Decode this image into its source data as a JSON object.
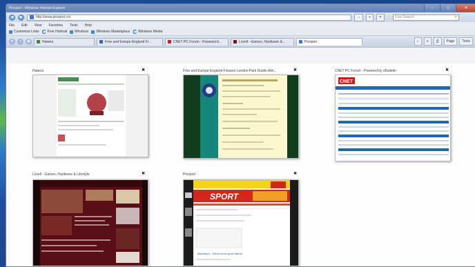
{
  "window": {
    "title": "Pinsport - Windows Internet Explorer",
    "controls": {
      "minimize": "–",
      "maximize": "□",
      "close": "✕"
    }
  },
  "address_bar": {
    "url": "http://www.pinsport.co/",
    "go_label": "→",
    "refresh_label": "+",
    "stop_label": "✕",
    "search_placeholder": "Live Search",
    "search_icon": "magnifier-icon"
  },
  "menu": [
    "File",
    "Edit",
    "View",
    "Favorites",
    "Tools",
    "Help"
  ],
  "links": [
    {
      "label": "Customize Links",
      "icon": "link-icon"
    },
    {
      "label": "Free Hotmail",
      "icon": "c-icon"
    },
    {
      "label": "Windows",
      "icon": "windows-icon"
    },
    {
      "label": "Windows Marketplace",
      "icon": "windows-icon"
    },
    {
      "label": "Windows Media",
      "icon": "c-icon"
    }
  ],
  "tabs": [
    {
      "label": "Hatena",
      "color": "#3c8a3a"
    },
    {
      "label": "Free and Europe England Fr...",
      "color": "#2f6fa5"
    },
    {
      "label": "CNET PC Forum - Powered b...",
      "color": "#c52020"
    },
    {
      "label": "Lovell - Games, Hardware &...",
      "color": "#7a1a1a"
    },
    {
      "label": "Pinsport",
      "color": "#3d7bd0",
      "active": true
    }
  ],
  "toolbar": {
    "home": "⌂",
    "feeds": "≡",
    "print": "⎙",
    "page": "Page",
    "tools": "Tools"
  },
  "thumbnails": [
    {
      "title": "Hatena",
      "close": "✖"
    },
    {
      "title": "Free and Europe England Fixtures London Park Dublin Athl...",
      "close": "✖"
    },
    {
      "title": "CNET PC Forum - Powered by vBulletin",
      "close": "✖"
    },
    {
      "title": "Lovell - Games, Hardware & Lifestyle",
      "close": "✖"
    },
    {
      "title": "Pinsport",
      "close": "✖"
    }
  ],
  "thumb_text": {
    "cnet_logo": "CNET",
    "sport_banner": "SPORT",
    "pinsport_caption": "Blackburn - Some more sport videos"
  },
  "colors": {
    "accent": "#1e4f9e",
    "cnet_red": "#c81e1e",
    "cnet_blue": "#1f66b3",
    "lovell_maroon": "#5a0f16",
    "sport_red": "#d5261b",
    "sport_yellow": "#f2d21b",
    "fixtures_teal": "#16857a",
    "fixtures_cream": "#fdf7cf"
  }
}
